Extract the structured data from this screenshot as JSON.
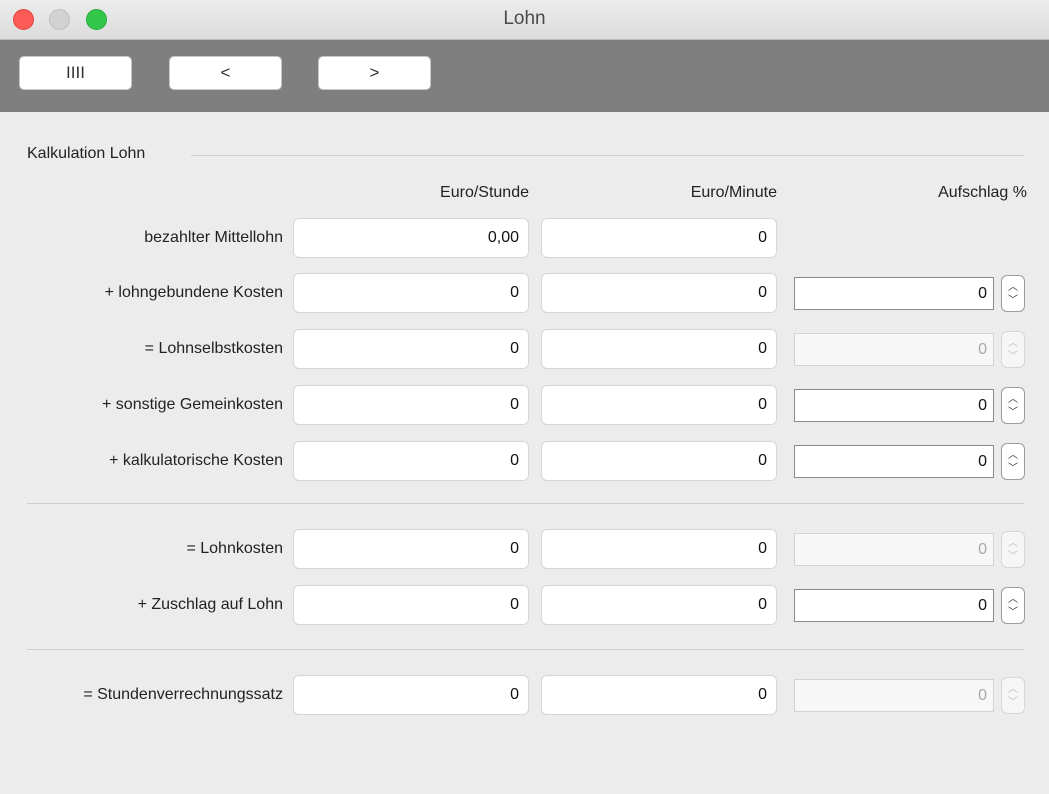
{
  "window": {
    "title": "Lohn"
  },
  "toolbar": {
    "buttons": [
      {
        "label": "IIII"
      },
      {
        "label": "<"
      },
      {
        "label": ">"
      }
    ]
  },
  "group": {
    "title": "Kalkulation Lohn"
  },
  "columns": {
    "c1": "Euro/Stunde",
    "c2": "Euro/Minute",
    "c3": "Aufschlag %"
  },
  "rows": [
    {
      "label": "bezahlter Mittellohn",
      "stunde": "0,00",
      "minute": "0"
    },
    {
      "label": "+ lohngebundene Kosten",
      "stunde": "0",
      "minute": "0",
      "aufschlag": "0",
      "enabled": true
    },
    {
      "label": "= Lohnselbstkosten",
      "stunde": "0",
      "minute": "0",
      "aufschlag": "0",
      "enabled": false
    },
    {
      "label": "+ sonstige Gemeinkosten",
      "stunde": "0",
      "minute": "0",
      "aufschlag": "0",
      "enabled": true
    },
    {
      "label": "+ kalkulatorische Kosten",
      "stunde": "0",
      "minute": "0",
      "aufschlag": "0",
      "enabled": true
    },
    {
      "label": "= Lohnkosten",
      "stunde": "0",
      "minute": "0",
      "aufschlag": "0",
      "enabled": false
    },
    {
      "label": "+ Zuschlag auf Lohn",
      "stunde": "0",
      "minute": "0",
      "aufschlag": "0",
      "enabled": true
    },
    {
      "label": "= Stundenverrechnungssatz",
      "stunde": "0",
      "minute": "0",
      "aufschlag": "0",
      "enabled": false
    }
  ]
}
